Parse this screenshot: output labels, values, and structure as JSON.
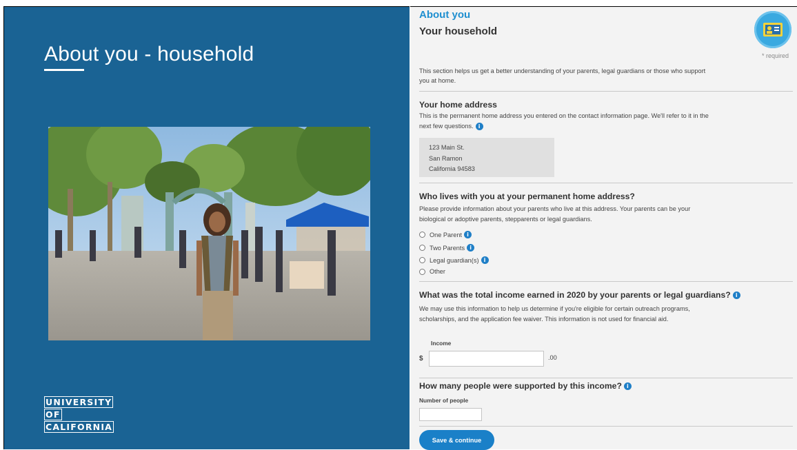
{
  "slide": {
    "title": "About you - household",
    "logo_lines": [
      "UNIVERSITY",
      "OF",
      "CALIFORNIA"
    ]
  },
  "form": {
    "kicker": "About you",
    "title": "Your household",
    "icon": "id-card-icon",
    "required_note": "* required",
    "intro": "This section helps us get a better understanding of your parents, legal guardians or those who support you at home.",
    "home_address": {
      "title": "Your home address",
      "description": "This is the permanent home address you entered on the contact information page. We'll refer to it in the next few questions.",
      "address_lines": [
        "123 Main St.",
        "San Ramon",
        "California 94583"
      ]
    },
    "who_lives": {
      "title": "Who lives with you at your permanent home address?",
      "description": "Please provide information about your parents who live at this address. Your parents can be your biological or adoptive parents, stepparents or legal guardians.",
      "options": [
        {
          "label": "One Parent",
          "info": true
        },
        {
          "label": "Two Parents",
          "info": true
        },
        {
          "label": "Legal guardian(s)",
          "info": true
        },
        {
          "label": "Other",
          "info": false
        }
      ]
    },
    "income": {
      "title": "What was the total income earned in 2020 by your parents or legal guardians?",
      "description": "We may use this information to help us determine if you're eligible for certain outreach programs, scholarships, and the application fee waiver. This information is not used for financial aid.",
      "field_label": "Income",
      "currency": "$",
      "value": "",
      "cents": ".00"
    },
    "people": {
      "title": "How many people were supported by this income?",
      "field_label": "Number of people",
      "value": ""
    },
    "save_label": "Save & continue"
  },
  "colors": {
    "slide_bg": "#1a6394",
    "accent": "#1f8fd0",
    "button": "#1a80c8",
    "form_bg": "#f3f3f3"
  }
}
